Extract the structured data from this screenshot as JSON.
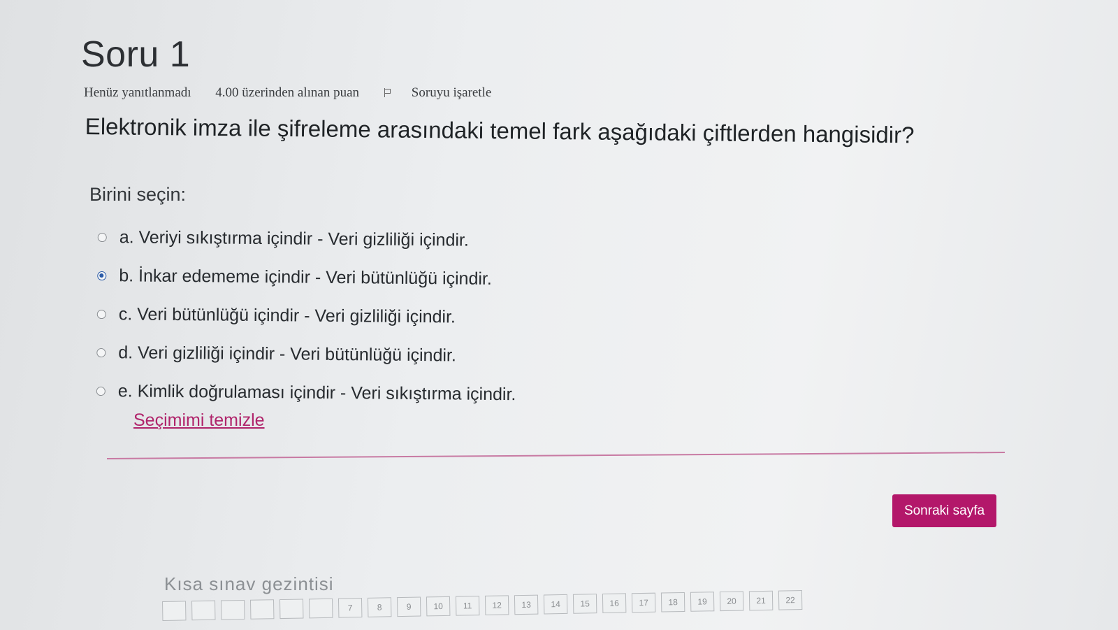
{
  "question": {
    "title": "Soru 1",
    "status": "Henüz yanıtlanmadı",
    "points": "4.00 üzerinden alınan puan",
    "flag_label": "Soruyu işaretle",
    "text": "Elektronik imza ile şifreleme arasındaki temel fark aşağıdaki çiftlerden hangisidir?",
    "prompt": "Birini seçin:",
    "answers": [
      {
        "label": "a. Veriyi sıkıştırma içindir - Veri gizliliği içindir.",
        "selected": false
      },
      {
        "label": "b. İnkar edememe içindir - Veri bütünlüğü içindir.",
        "selected": true
      },
      {
        "label": "c. Veri bütünlüğü içindir - Veri gizliliği içindir.",
        "selected": false
      },
      {
        "label": "d. Veri gizliliği içindir - Veri bütünlüğü içindir.",
        "selected": false
      },
      {
        "label": "e. Kimlik doğrulaması içindir - Veri sıkıştırma içindir.",
        "selected": false
      }
    ],
    "clear_label": "Seçimimi temizle"
  },
  "next_button_label": "Sonraki sayfa",
  "navigation": {
    "title": "Kısa sınav gezintisi",
    "buttons": [
      "",
      "",
      "",
      "",
      "",
      "",
      "7",
      "8",
      "9",
      "10",
      "11",
      "12",
      "13",
      "14",
      "15",
      "16",
      "17",
      "18",
      "19",
      "20",
      "21",
      "22"
    ]
  },
  "colors": {
    "accent": "#b3176a",
    "link": "#b0246b",
    "radio_selected": "#2a5ba8"
  }
}
